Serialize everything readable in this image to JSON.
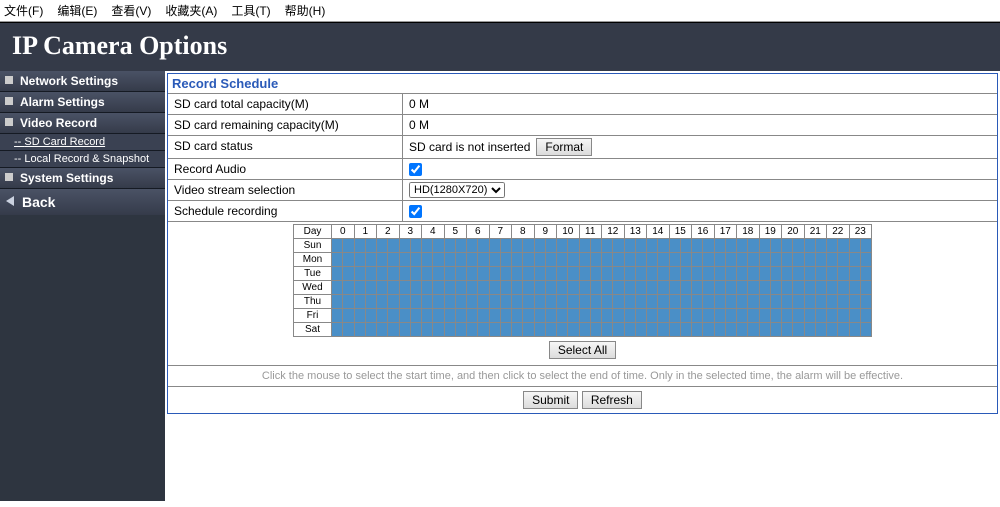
{
  "menubar": [
    "文件(F)",
    "编辑(E)",
    "查看(V)",
    "收藏夹(A)",
    "工具(T)",
    "帮助(H)"
  ],
  "header": {
    "title": "IP Camera Options"
  },
  "sidebar": {
    "items": [
      {
        "label": "Network Settings",
        "type": "main"
      },
      {
        "label": "Alarm Settings",
        "type": "main"
      },
      {
        "label": "Video Record",
        "type": "main"
      },
      {
        "label": "SD Card Record",
        "type": "sub",
        "active": true
      },
      {
        "label": "Local Record & Snapshot",
        "type": "sub"
      },
      {
        "label": "System Settings",
        "type": "main"
      }
    ],
    "back": "Back"
  },
  "panel": {
    "title": "Record Schedule",
    "rows": {
      "totalCap": {
        "label": "SD card total capacity(M)",
        "value": "0 M"
      },
      "remainCap": {
        "label": "SD card remaining capacity(M)",
        "value": "0 M"
      },
      "status": {
        "label": "SD card status",
        "value": "SD card is not inserted",
        "button": "Format"
      },
      "audio": {
        "label": "Record Audio",
        "checked": true
      },
      "stream": {
        "label": "Video stream selection",
        "options": [
          "HD(1280X720)"
        ],
        "selected": "HD(1280X720)"
      },
      "schedRec": {
        "label": "Schedule recording",
        "checked": true
      }
    },
    "schedule": {
      "dayHeader": "Day",
      "hours": [
        0,
        1,
        2,
        3,
        4,
        5,
        6,
        7,
        8,
        9,
        10,
        11,
        12,
        13,
        14,
        15,
        16,
        17,
        18,
        19,
        20,
        21,
        22,
        23
      ],
      "days": [
        "Sun",
        "Mon",
        "Tue",
        "Wed",
        "Thu",
        "Fri",
        "Sat"
      ]
    },
    "selectAll": "Select All",
    "hint": "Click the mouse to select the start time, and then click to select the end of time. Only in the selected time, the alarm will be effective.",
    "submit": "Submit",
    "refresh": "Refresh"
  }
}
